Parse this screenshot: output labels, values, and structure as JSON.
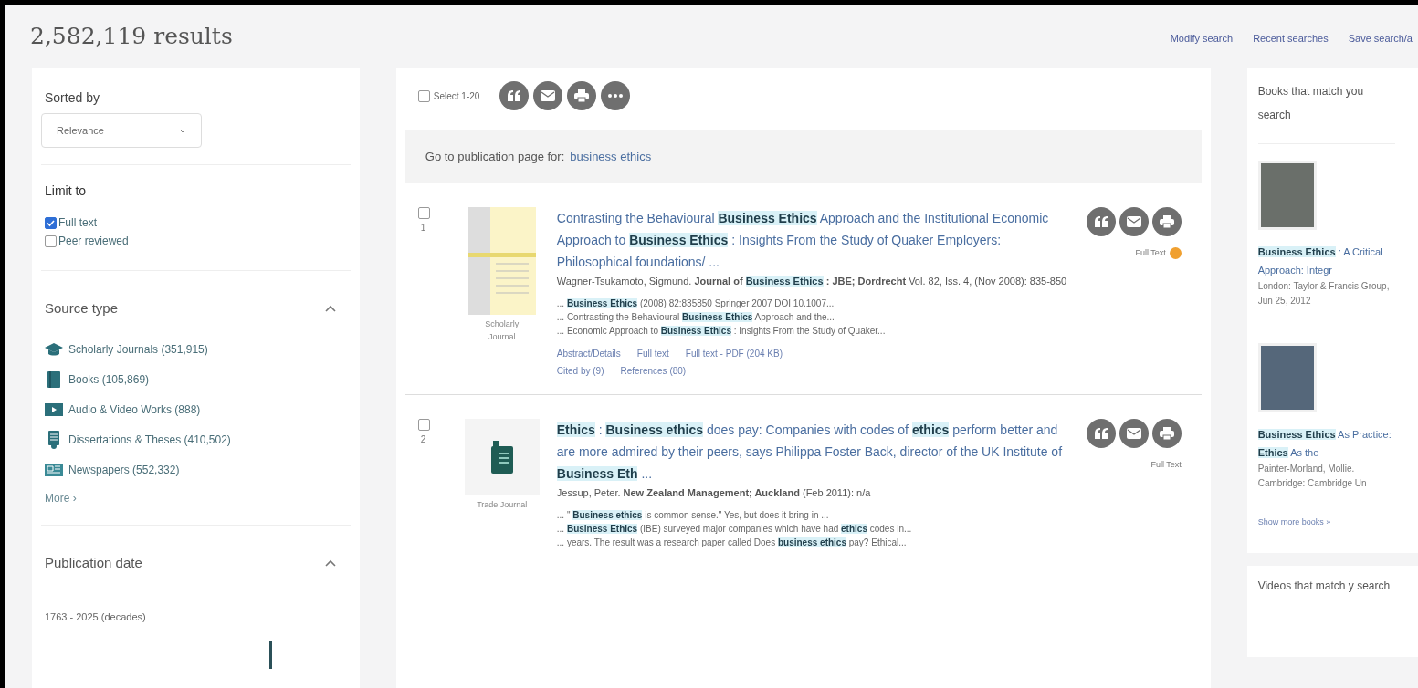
{
  "header": {
    "results": "2,582,119 results",
    "links": [
      "Modify search",
      "Recent searches",
      "Save search/a"
    ]
  },
  "sidebar": {
    "sort": {
      "label": "Sorted by",
      "value": "Relevance"
    },
    "limit": {
      "label": "Limit to",
      "options": [
        {
          "label": "Full text",
          "checked": true
        },
        {
          "label": "Peer reviewed",
          "checked": false
        }
      ]
    },
    "source_type": {
      "title": "Source type",
      "expanded": true,
      "items": [
        {
          "kind": "journal",
          "label": "Scholarly Journals (351,915)"
        },
        {
          "kind": "book",
          "label": "Books (105,869)"
        },
        {
          "kind": "video",
          "label": "Audio & Video Works (888)"
        },
        {
          "kind": "thesis",
          "label": "Dissertations & Theses (410,502)"
        },
        {
          "kind": "newspaper",
          "label": "Newspapers (552,332)"
        }
      ],
      "more": "More ›"
    },
    "publication_date": {
      "title": "Publication date",
      "expanded": true,
      "range": "1763 - 2025 (decades)"
    }
  },
  "toolbar": {
    "select_label": "Select 1-20",
    "checked": false
  },
  "publication_banner": {
    "text": "Go to publication page for:",
    "link": "business ethics"
  },
  "results": [
    {
      "number": "1",
      "checked": false,
      "kind": "cover",
      "doc_type": "Scholarly Journal",
      "title": [
        {
          "t": "Contrasting the Behavioural",
          "hl": false
        },
        {
          "t": "**Business Ethics**",
          "hl": true
        },
        {
          "t": "Approach and the Institutional Economic Approach to",
          "hl": false
        },
        {
          "t": "**Business Ethics**",
          "hl": true
        },
        {
          "t": ": Insights From the Study of Quaker Employers: Philosophical foundations/ ...",
          "hl": false
        }
      ],
      "meta": [
        {
          "t": "Wagner-Tsukamoto, Sigmund. **Journal of**",
          "hl": false
        },
        {
          "t": "**Business Ethics**",
          "hl": true
        },
        {
          "t": "**: JBE; Dordrecht** Vol. 82, Iss. 4, (Nov 2008): 835-850",
          "hl": false
        }
      ],
      "snippets": [
        [
          {
            "t": "...",
            "hl": false
          },
          {
            "t": "**Business Ethics**",
            "hl": true
          },
          {
            "t": "(2008) 82:835850 Springer 2007 DOI 10.1007...",
            "hl": false
          }
        ],
        [
          {
            "t": "... Contrasting the Behavioural",
            "hl": false
          },
          {
            "t": "**Business Ethics**",
            "hl": true
          },
          {
            "t": "Approach and the...",
            "hl": false
          }
        ],
        [
          {
            "t": "... Economic Approach to",
            "hl": false
          },
          {
            "t": "**Business Ethics**",
            "hl": true
          },
          {
            "t": ": Insights From the Study of Quaker...",
            "hl": false
          }
        ]
      ],
      "links": [
        [
          "Abstract/Details",
          "Full text",
          "Full text - PDF (204 KB)"
        ],
        [
          "Cited by (9)",
          "References (80)"
        ]
      ],
      "full_text": "Full Text",
      "badge": true
    },
    {
      "number": "2",
      "checked": false,
      "kind": "trade",
      "doc_type": "Trade Journal",
      "title": [
        {
          "t": "**Ethics**",
          "hl": true
        },
        {
          "t": ":",
          "hl": false
        },
        {
          "t": "**Business ethics**",
          "hl": true
        },
        {
          "t": "does pay: Companies with codes of",
          "hl": false
        },
        {
          "t": "**ethics**",
          "hl": true
        },
        {
          "t": "perform better and are more admired by their peers, says Philippa Foster Back, director of the UK Institute of",
          "hl": false
        },
        {
          "t": "**Business Eth**",
          "hl": true
        },
        {
          "t": "...",
          "hl": false
        }
      ],
      "meta": [
        {
          "t": "Jessup, Peter. **New Zealand Management; Auckland** (Feb 2011): n/a",
          "hl": false
        }
      ],
      "snippets": [
        [
          {
            "t": "... \"",
            "hl": false
          },
          {
            "t": "**Business ethics**",
            "hl": true
          },
          {
            "t": "is common sense.\" Yes, but does it bring in ...",
            "hl": false
          }
        ],
        [
          {
            "t": "...",
            "hl": false
          },
          {
            "t": "**Business Ethics**",
            "hl": true
          },
          {
            "t": "(IBE) surveyed major companies which have had",
            "hl": false
          },
          {
            "t": "**ethics**",
            "hl": true
          },
          {
            "t": "codes in...",
            "hl": false
          }
        ],
        [
          {
            "t": "... years. The result was a research paper called Does",
            "hl": false
          },
          {
            "t": "**business ethics**",
            "hl": true
          },
          {
            "t": "pay? Ethical...",
            "hl": false
          }
        ]
      ],
      "full_text": "Full Text",
      "badge": false
    }
  ],
  "books": {
    "title": "Books that match you search",
    "items": [
      {
        "title": [
          {
            "t": "**Business Ethics**",
            "hl": true
          },
          {
            "t": ": A Critical Approach: Integr",
            "hl": false
          }
        ],
        "lines": [
          "London: Taylor & Francis Group, Jun 25, 2012"
        ]
      },
      {
        "title": [
          {
            "t": "**Business Ethics**",
            "hl": true
          },
          {
            "t": "As Practice:",
            "hl": false
          },
          {
            "t": "**Ethics**",
            "hl": true
          },
          {
            "t": "As the",
            "hl": false
          }
        ],
        "lines": [
          "Painter-Morland, Mollie.",
          "Cambridge: Cambridge Un"
        ]
      }
    ],
    "more": "Show more books »"
  },
  "videos": {
    "title": "Videos that match y search"
  }
}
